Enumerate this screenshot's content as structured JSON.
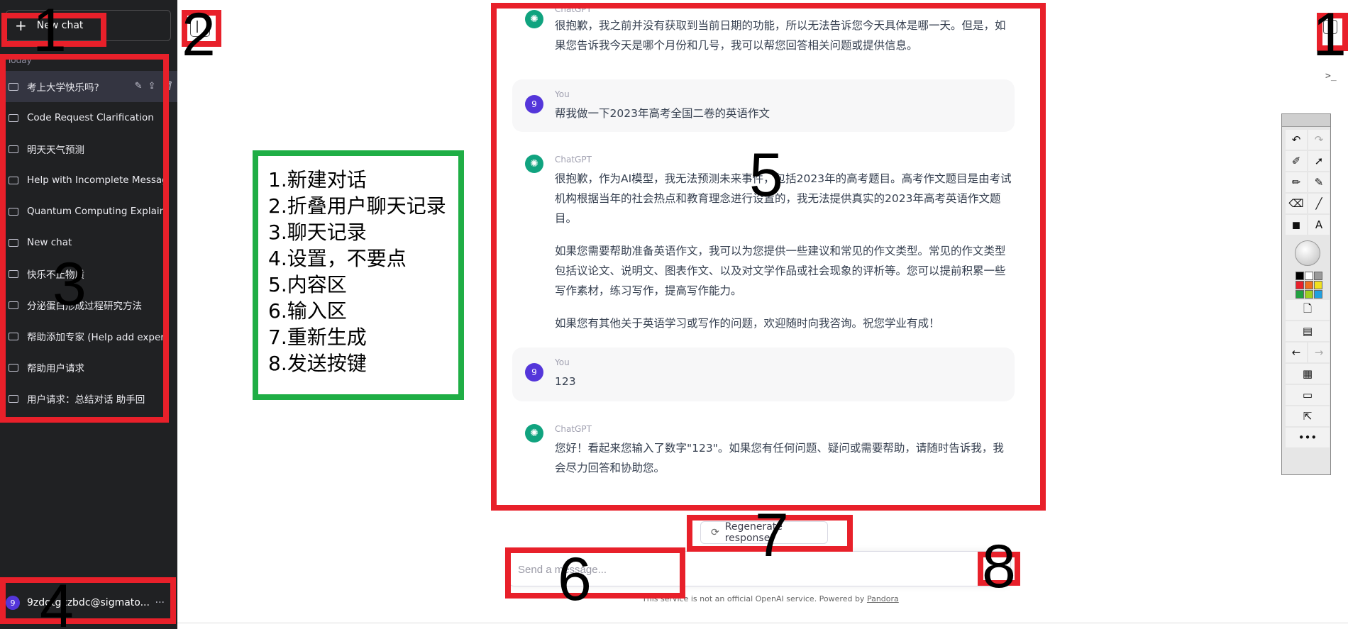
{
  "sidebar": {
    "new_chat": "New chat",
    "section": "Today",
    "items": [
      {
        "label": "考上大学快乐吗?",
        "active": true
      },
      {
        "label": "Code Request Clarification"
      },
      {
        "label": "明天天气预测"
      },
      {
        "label": "Help with Incomplete Messag"
      },
      {
        "label": "Quantum Computing Explaine"
      },
      {
        "label": "New chat"
      },
      {
        "label": "快乐不止物质"
      },
      {
        "label": "分泌蛋白形成过程研究方法"
      },
      {
        "label": "帮助添加专家 (Help add expert"
      },
      {
        "label": "帮助用户请求"
      },
      {
        "label": "用户请求：总结对话 助手回"
      }
    ],
    "user": {
      "avatar": "9",
      "email": "9zdqtgxzbdc@sigmato..."
    },
    "more": "···"
  },
  "legend": [
    "1.新建对话",
    "2.折叠用户聊天记录",
    "3.聊天记录",
    "4.设置，不要点",
    "5.内容区",
    "6.输入区",
    "7.重新生成",
    "8.发送按键"
  ],
  "annotations": {
    "n1": "1",
    "n2": "2",
    "n3": "3",
    "n4": "4",
    "n5": "5",
    "n6": "6",
    "n7": "7",
    "n8": "8",
    "n1b": "1"
  },
  "conversation": [
    {
      "role": "ChatGPT",
      "paragraphs": [
        "很抱歉，我之前并没有获取到当前日期的功能，所以无法告诉您今天具体是哪一天。但是，如果您告诉我今天是哪个月份和几号，我可以帮您回答相关问题或提供信息。"
      ]
    },
    {
      "role": "You",
      "paragraphs": [
        "帮我做一下2023年高考全国二卷的英语作文"
      ]
    },
    {
      "role": "ChatGPT",
      "paragraphs": [
        "很抱歉，作为AI模型，我无法预测未来事件，包括2023年的高考题目。高考作文题目是由考试机构根据当年的社会热点和教育理念进行设置的，我无法提供真实的2023年高考英语作文题目。",
        "如果您需要帮助准备英语作文，我可以为您提供一些建议和常见的作文类型。常见的作文类型包括议论文、说明文、图表作文、以及对文学作品或社会现象的评析等。您可以提前积累一些写作素材，练习写作，提高写作能力。",
        "如果您有其他关于英语学习或写作的问题，欢迎随时向我咨询。祝您学业有成！"
      ]
    },
    {
      "role": "You",
      "paragraphs": [
        "123"
      ]
    },
    {
      "role": "ChatGPT",
      "paragraphs": [
        "您好！看起来您输入了数字\"123\"。如果您有任何问题、疑问或需要帮助，请随时告诉我，我会尽力回答和协助您。"
      ]
    }
  ],
  "user_avatar": "9",
  "regenerate": "Regenerate response",
  "input": {
    "placeholder": "Send a message..."
  },
  "footer": {
    "text": "This service is not an official OpenAI service. Powered by ",
    "link": "Pandora"
  },
  "colors": {
    "annotation_red": "#e8202a",
    "annotation_green": "#1fae45",
    "sidebar_bg": "#202123",
    "chatgpt_green": "#10a37f",
    "user_purple": "#5436da"
  }
}
